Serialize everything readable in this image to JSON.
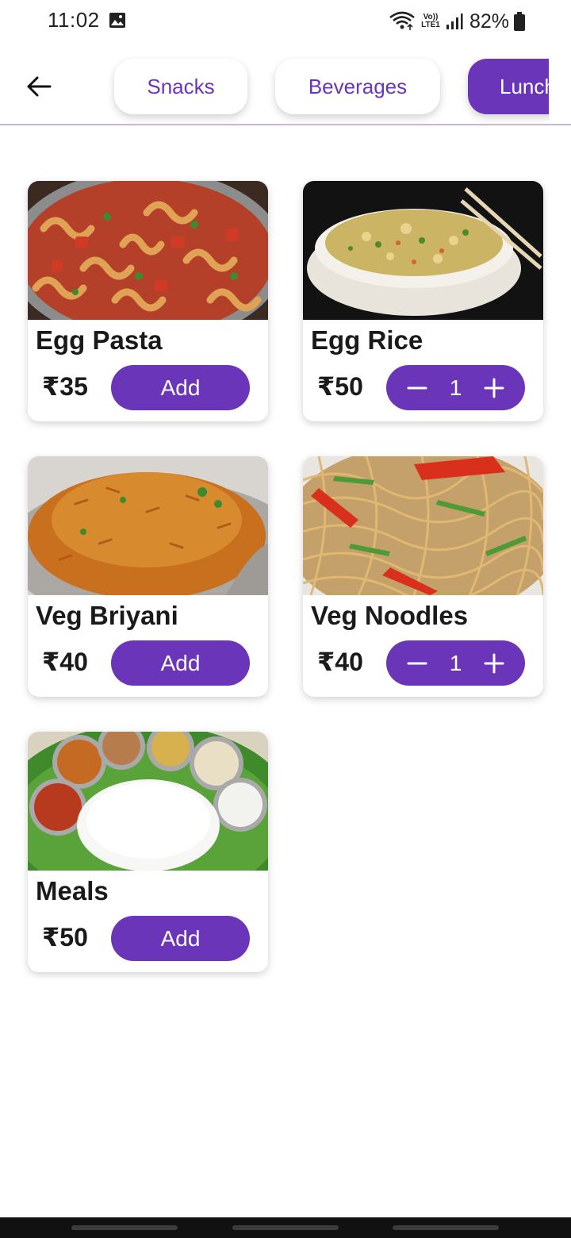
{
  "status_bar": {
    "time": "11:02",
    "network": "Vo)) LTE1",
    "battery": "82%",
    "icons": [
      "gallery-icon",
      "wifi-icon",
      "signal-icon",
      "battery-icon"
    ]
  },
  "top_bar": {
    "back_icon": "arrow-left-icon",
    "tabs": [
      {
        "label": "Snacks",
        "active": false
      },
      {
        "label": "Beverages",
        "active": false
      },
      {
        "label": "Lunch",
        "active": true
      }
    ]
  },
  "items": [
    {
      "name": "Egg Pasta",
      "price": "₹35",
      "action": "Add"
    },
    {
      "name": "Egg Rice",
      "price": "₹50",
      "quantity": "1"
    },
    {
      "name": "Veg Briyani",
      "price": "₹40",
      "action": "Add"
    },
    {
      "name": "Veg Noodles",
      "price": "₹40",
      "quantity": "1"
    },
    {
      "name": "Meals",
      "price": "₹50",
      "action": "Add"
    }
  ],
  "colors": {
    "accent": "#6a35b8",
    "divider": "#c9b6d9",
    "text": "#1a1a1a"
  }
}
